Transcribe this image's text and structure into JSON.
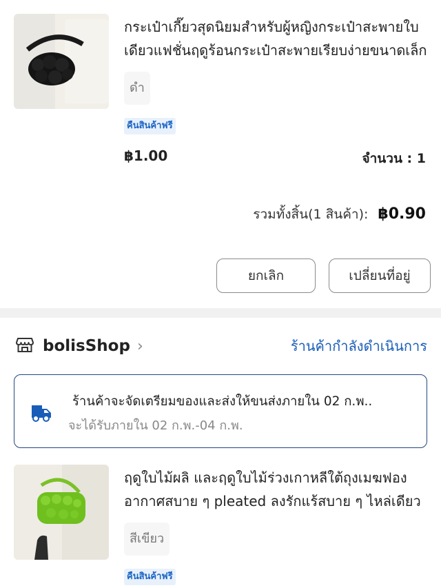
{
  "item1": {
    "title": "กระเป๋าเกี๊ยวสุดนิยมสำหรับผู้หญิงกระเป๋าสะพายใบเดียวแฟชั่นฤดูร้อนกระเป๋าสะพายเรียบง่ายขนาดเล็ก",
    "variant": "ดำ",
    "badge": "คืนสินค้าฟรี",
    "price": "฿1.00",
    "quantity": "จำนวน : 1",
    "total_label": "รวมทั้งสิ้น(1 สินค้า):",
    "total_value": "฿0.90",
    "cancel_label": "ยกเลิก",
    "change_address_label": "เปลี่ยนที่อยู่"
  },
  "shop": {
    "name": "bolisShop",
    "status": "ร้านค้ากำลังดำเนินการ",
    "notice_line1": "ร้านค้าจะจัดเตรียมของและส่งให้ขนส่งภายใน 02 ก.พ..",
    "notice_line2": "จะได้รับภายใน 02 ก.พ.-04 ก.พ."
  },
  "item2": {
    "title": "ฤดูใบไม้ผลิ และฤดูใบไม้ร่วงเกาหลีใต้ถุงเมฆฟองอากาศสบาย ๆ pleated ลงรักแร้สบาย ๆ ไหล่เดียว",
    "variant": "สีเขียว",
    "badge": "คืนสินค้าฟรี"
  },
  "colors": {
    "accent_blue": "#1a5db8",
    "notice_border": "#21467f",
    "badge_bg": "#e8f1fb"
  }
}
